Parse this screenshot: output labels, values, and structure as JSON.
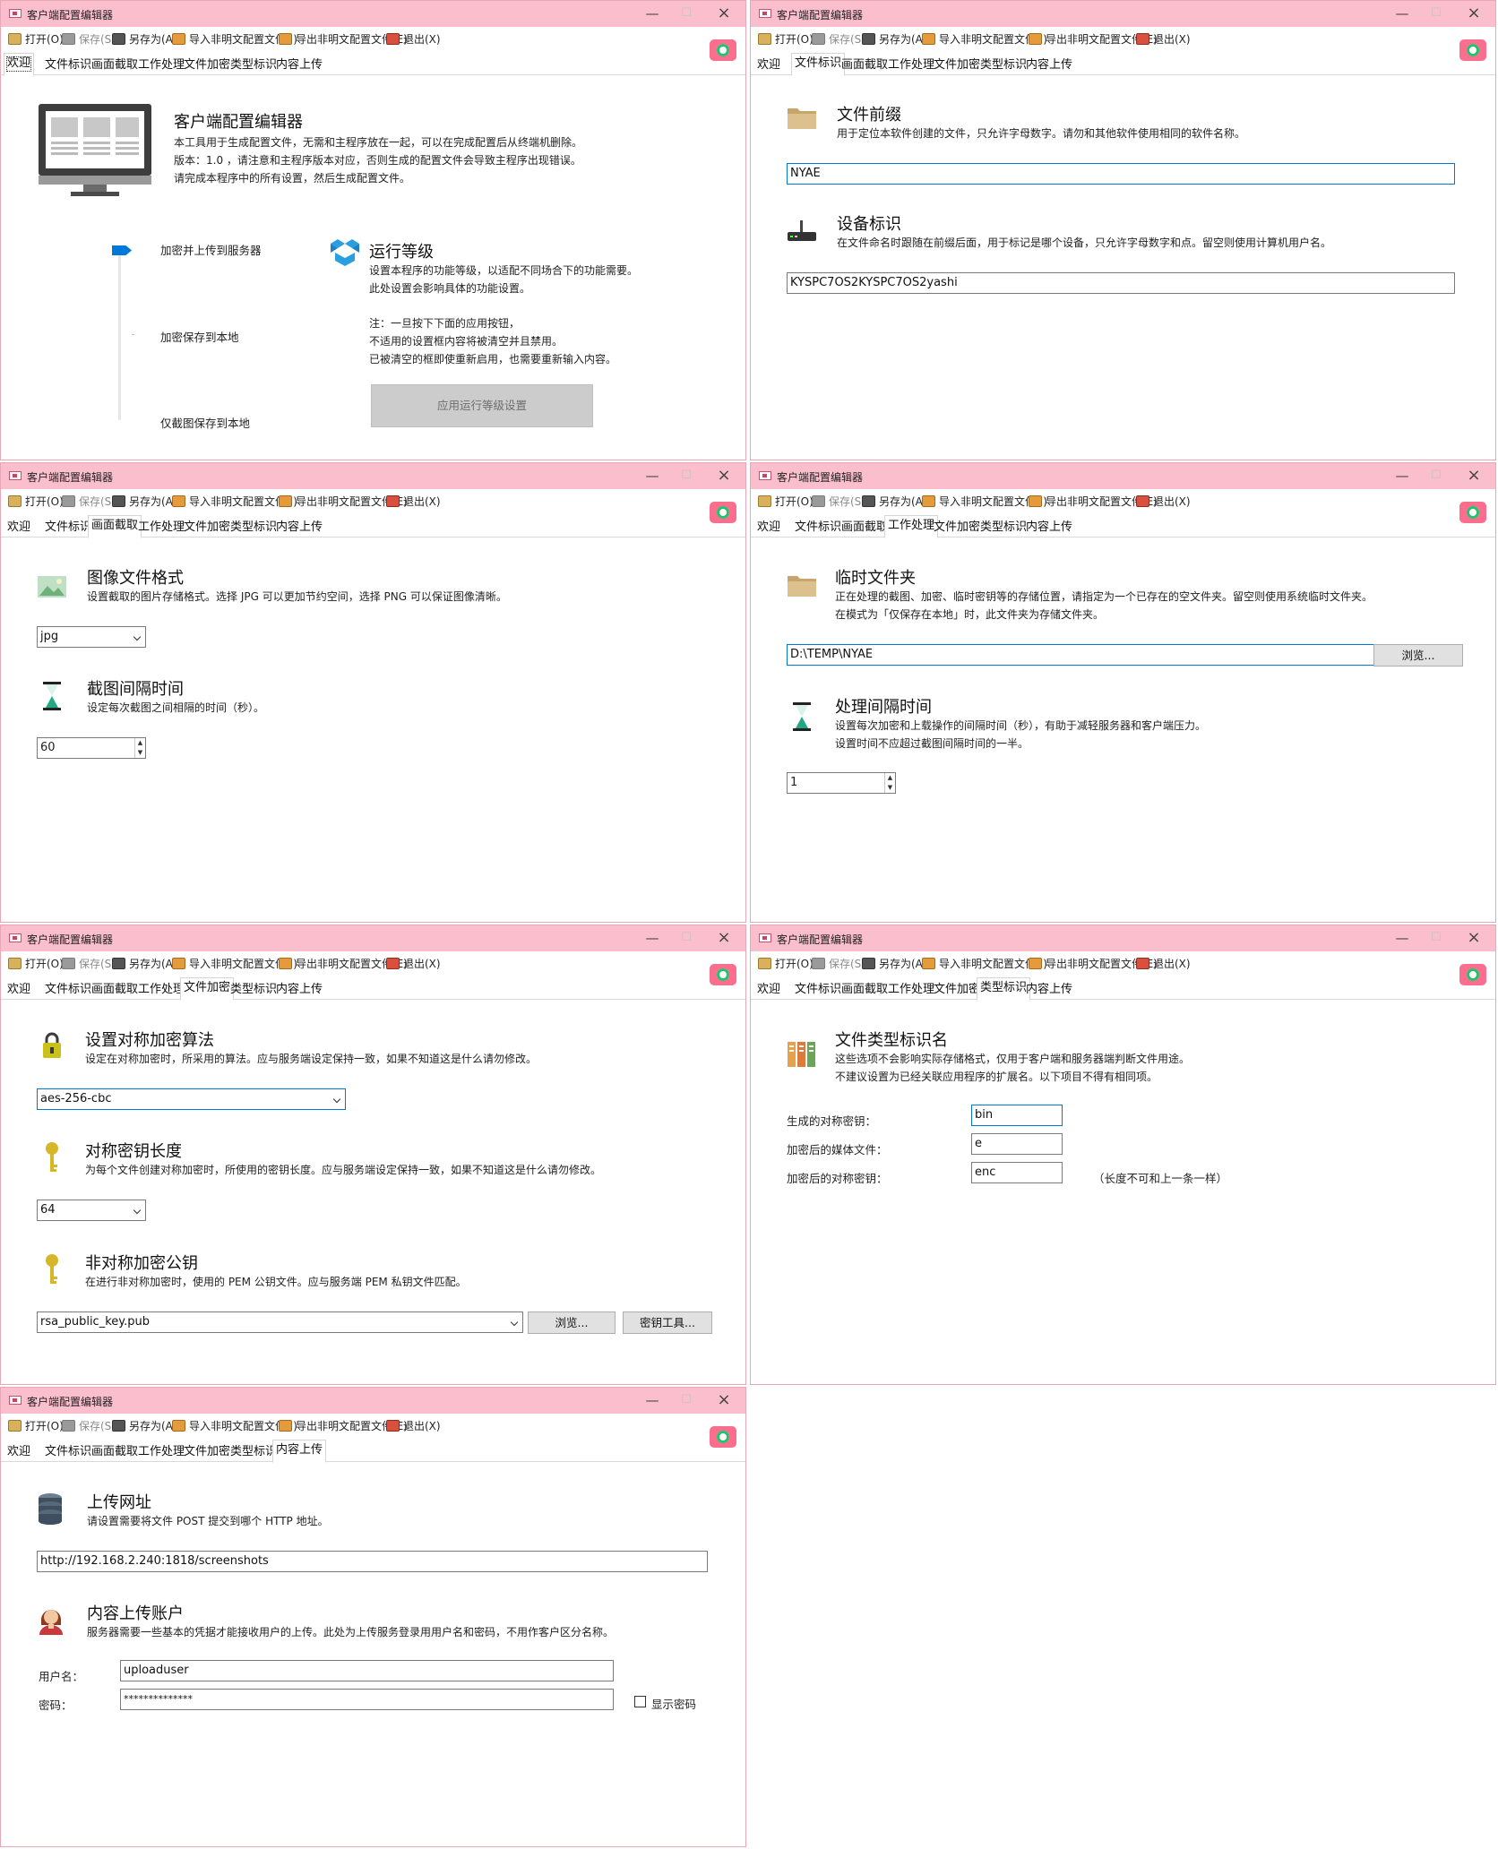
{
  "app": {
    "title": "客户端配置编辑器"
  },
  "menu": {
    "open": "打开(O)",
    "save": "保存(S)",
    "save_as": "另存为(A)",
    "import": "导入非明文配置文件(I)",
    "export": "导出非明文配置文件(E)",
    "exit": "退出(X)"
  },
  "tabs": [
    "欢迎",
    "文件标识",
    "画面截取",
    "工作处理",
    "文件加密",
    "类型标识",
    "内容上传"
  ],
  "welcome": {
    "heading": "客户端配置编辑器",
    "desc1": "本工具用于生成配置文件，无需和主程序放在一起，可以在完成配置后从终端机删除。",
    "desc2": "版本：1.0 ，请注意和主程序版本对应，否则生成的配置文件会导致主程序出现错误。",
    "desc3": "请完成本程序中的所有设置，然后生成配置文件。",
    "level_opt1": "加密并上传到服务器",
    "level_opt2": "加密保存到本地",
    "level_opt3": "仅截图保存到本地",
    "level_selected": 1,
    "level_heading": "运行等级",
    "level_desc1": "设置本程序的功能等级，以适配不同场合下的功能需要。",
    "level_desc2": "此处设置会影响具体的功能设置。",
    "note1": "注：一旦按下下面的应用按钮，",
    "note2": "不适用的设置框内容将被清空并且禁用。",
    "note3": "已被清空的框即使重新启用，也需要重新输入内容。",
    "apply_button": "应用运行等级设置"
  },
  "file_id": {
    "prefix_heading": "文件前缀",
    "prefix_desc": "用于定位本软件创建的文件，只允许字母数字。请勿和其他软件使用相同的软件名称。",
    "prefix_value": "NYAE",
    "device_heading": "设备标识",
    "device_desc": "在文件命名时跟随在前缀后面，用于标记是哪个设备，只允许字母数字和点。留空则使用计算机用户名。",
    "device_value": "KYSPC7OS2KYSPC7OS2yashi"
  },
  "capture": {
    "format_heading": "图像文件格式",
    "format_desc": "设置截取的图片存储格式。选择 JPG 可以更加节约空间，选择 PNG 可以保证图像清晰。",
    "format_value": "jpg",
    "interval_heading": "截图间隔时间",
    "interval_desc": "设定每次截图之间相隔的时间（秒）。",
    "interval_value": "60"
  },
  "work": {
    "temp_heading": "临时文件夹",
    "temp_desc1": "正在处理的截图、加密、临时密钥等的存储位置，请指定为一个已存在的空文件夹。留空则使用系统临时文件夹。",
    "temp_desc2": "在模式为「仅保存在本地」时，此文件夹为存储文件夹。",
    "temp_value": "D:\\TEMP\\NYAE",
    "browse": "浏览...",
    "interval_heading": "处理间隔时间",
    "interval_desc1": "设置每次加密和上载操作的间隔时间（秒），有助于减轻服务器和客户端压力。",
    "interval_desc2": "设置时间不应超过截图间隔时间的一半。",
    "interval_value": "1"
  },
  "encrypt": {
    "algo_heading": "设置对称加密算法",
    "algo_desc": "设定在对称加密时，所采用的算法。应与服务端设定保持一致，如果不知道这是什么请勿修改。",
    "algo_value": "aes-256-cbc",
    "keylen_heading": "对称密钥长度",
    "keylen_desc": "为每个文件创建对称加密时，所使用的密钥长度。应与服务端设定保持一致，如果不知道这是什么请勿修改。",
    "keylen_value": "64",
    "pubkey_heading": "非对称加密公钥",
    "pubkey_desc": "在进行非对称加密时，使用的 PEM 公钥文件。应与服务端 PEM 私钥文件匹配。",
    "pubkey_value": "rsa_public_key.pub",
    "browse": "浏览...",
    "keytool": "密钥工具..."
  },
  "types": {
    "heading": "文件类型标识名",
    "desc1": "这些选项不会影响实际存储格式，仅用于客户端和服务器端判断文件用途。",
    "desc2": "不建议设置为已经关联应用程序的扩展名。以下项目不得有相同项。",
    "label1": "生成的对称密钥：",
    "value1": "bin",
    "label2": "加密后的媒体文件：",
    "value2": "e",
    "label3": "加密后的对称密钥：",
    "value3": "enc",
    "note": "（长度不可和上一条一样）"
  },
  "upload": {
    "url_heading": "上传网址",
    "url_desc": "请设置需要将文件 POST 提交到哪个 HTTP 地址。",
    "url_value": "http://192.168.2.240:1818/screenshots",
    "acct_heading": "内容上传账户",
    "acct_desc": "服务器需要一些基本的凭据才能接收用户的上传。此处为上传服务登录用用户名和密码，不用作客户区分名称。",
    "user_label": "用户名：",
    "user_value": "uploaduser",
    "pass_label": "密码：",
    "pass_value": "**************",
    "show_pass": "显示密码"
  }
}
